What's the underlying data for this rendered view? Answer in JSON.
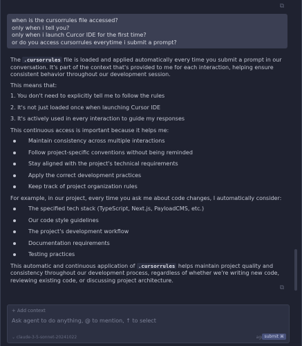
{
  "user_message": {
    "lines": [
      "when is the cursorrules file accessed?",
      "only when i tell you?",
      "only when i launch Curcor IDE for the first time?",
      "or do you access cursorrules everytime i submit a prompt?"
    ]
  },
  "answer": {
    "intro_before": "The ",
    "intro_code": ".cursorrules",
    "intro_after": " file is loaded and applied automatically every time you submit a prompt in our conversation. It's part of the context that's provided to me for each interaction, helping ensure consistent behavior throughout our development session.",
    "means_heading": "This means that:",
    "numbered": [
      "1. You don't need to explicitly tell me to follow the rules",
      "2. It's not just loaded once when launching Cursor IDE",
      "3. It's actively used in every interaction to guide my responses"
    ],
    "important_heading": "This continuous access is important because it helps me:",
    "helps": [
      "Maintain consistency across multiple interactions",
      "Follow project-specific conventions without being reminded",
      "Stay aligned with the project's technical requirements",
      "Apply the correct development practices",
      "Keep track of project organization rules"
    ],
    "example_heading": "For example, in our project, every time you ask me about code changes, I automatically consider:",
    "considers": [
      "The specified tech stack (TypeScript, Next.js, PayloadCMS, etc.)",
      "Our code style guidelines",
      "The project's development workflow",
      "Documentation requirements",
      "Testing practices"
    ],
    "outro_before": "This automatic and continuous application of ",
    "outro_code": ".cursorrules",
    "outro_after": " helps maintain project quality and consistency throughout our development process, regardless of whether we're writing new code, reviewing existing code, or discussing project architecture."
  },
  "composer": {
    "add_context": "+ Add context",
    "placeholder": "Ask agent to do anything, @ to mention, ↑ to select",
    "model": "⌄ claude-3-5-sonnet-20241022",
    "mode": "agent",
    "submit": "submit ⌘"
  },
  "icons": {
    "copy": "⧉"
  }
}
